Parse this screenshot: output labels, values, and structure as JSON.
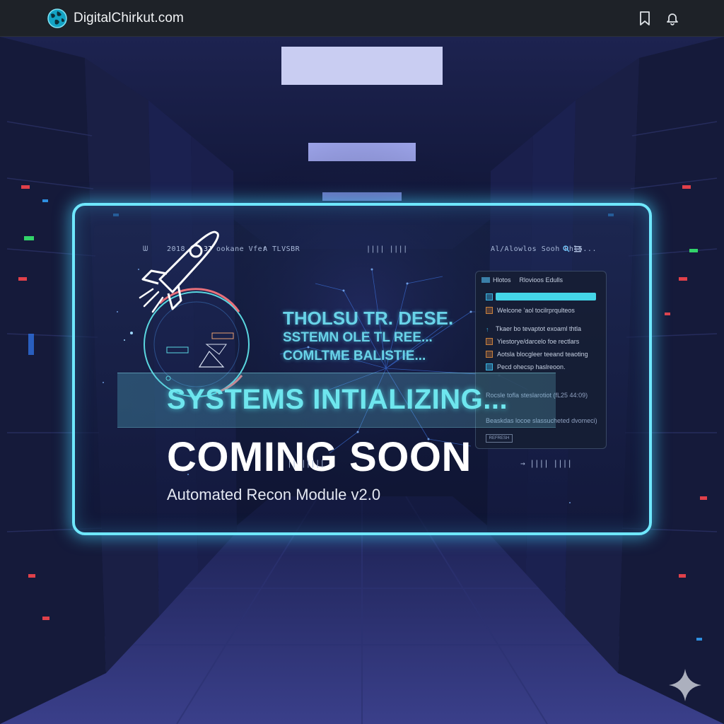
{
  "topbar": {
    "site_name": "DigitalChirkut.com",
    "icons": [
      "globe-icon",
      "bookmark-icon",
      "notification-icon"
    ]
  },
  "panel": {
    "hud_left": [
      "ᗯ",
      "2018",
      "3T",
      "ookane Vfer",
      "A TLVSBR"
    ],
    "hud_center": "∣∣∣∣ ∣∣∣∣",
    "hud_right": "Al/Alowlos Sooh Rhl5...",
    "glitch_lines": [
      "THOLSU TR. DESE.",
      "SSTEMN OLE TL REE...",
      "COMLTME BALISTIE..."
    ],
    "status_text": "SYSTEMS INTIALIZING...",
    "headline": "COMING SOON",
    "subtitle": "Automated Recon Module v2.0",
    "bottom_hud_left": "∣∣ ∣∣∣∣∣",
    "bottom_hud_right": "→ ∣∣∣∣ ∣∣∣∣"
  },
  "side_window": {
    "tab_label": "Hlotos",
    "title": "Rlovioos Edulls",
    "rows": [
      {
        "icon": "orange",
        "text": "Welcone ’aol tocilrprqulteos"
      },
      {
        "icon": "blue-arrow",
        "text": "Tkaer bo tevaptot exoaml thtla"
      },
      {
        "icon": "orange",
        "text": "Yiestorye/darcelo foe rectlars"
      },
      {
        "icon": "orange",
        "text": "Aotsla blocgleer teeand teaoting"
      },
      {
        "icon": "blue",
        "text": "Pecd ohecsp haslreoon."
      }
    ],
    "footer_line_1": "Rocsle tofla steslarotiot (fL25 44:09)",
    "footer_line_2": "Beaskdas locoe slassucheted dvomeci)",
    "button": "REFRESH"
  },
  "colors": {
    "accent_cyan": "#6fe8ff",
    "status_cyan": "#6ee6ee",
    "topbar_bg": "#1e2228"
  }
}
